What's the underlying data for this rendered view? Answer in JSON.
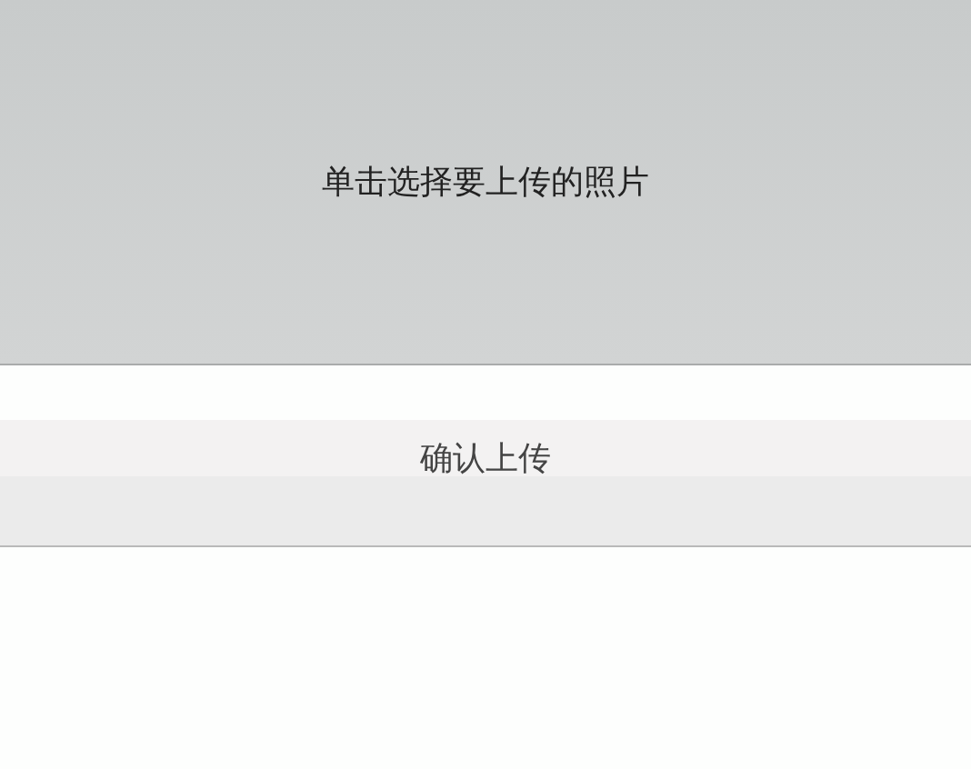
{
  "photo_picker": {
    "label": "单击选择要上传的照片"
  },
  "confirm_button": {
    "label": "确认上传"
  }
}
